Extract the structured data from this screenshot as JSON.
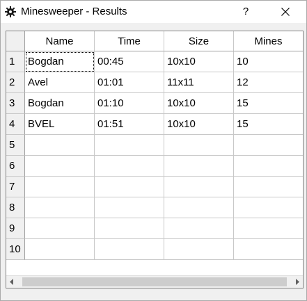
{
  "window": {
    "title": "Minesweeper - Results",
    "help_label": "?",
    "icon": "gear-icon"
  },
  "table": {
    "columns": [
      "Name",
      "Time",
      "Size",
      "Mines"
    ],
    "row_numbers": [
      "1",
      "2",
      "3",
      "4",
      "5",
      "6",
      "7",
      "8",
      "9",
      "10"
    ],
    "rows": [
      [
        "Bogdan",
        "00:45",
        "10x10",
        "10"
      ],
      [
        "Avel",
        "01:01",
        "11x11",
        "12"
      ],
      [
        "Bogdan",
        "01:10",
        "10x10",
        "15"
      ],
      [
        "BVEL",
        "01:51",
        "10x10",
        "15"
      ],
      [
        "",
        "",
        "",
        ""
      ],
      [
        "",
        "",
        "",
        ""
      ],
      [
        "",
        "",
        "",
        ""
      ],
      [
        "",
        "",
        "",
        ""
      ],
      [
        "",
        "",
        "",
        ""
      ],
      [
        "",
        "",
        "",
        ""
      ]
    ]
  },
  "colors": {
    "title_bar": "#ffffff",
    "window_bg": "#f0f0f0",
    "grid_line": "#c8c8c8",
    "scroll_thumb": "#cdcdcd"
  }
}
